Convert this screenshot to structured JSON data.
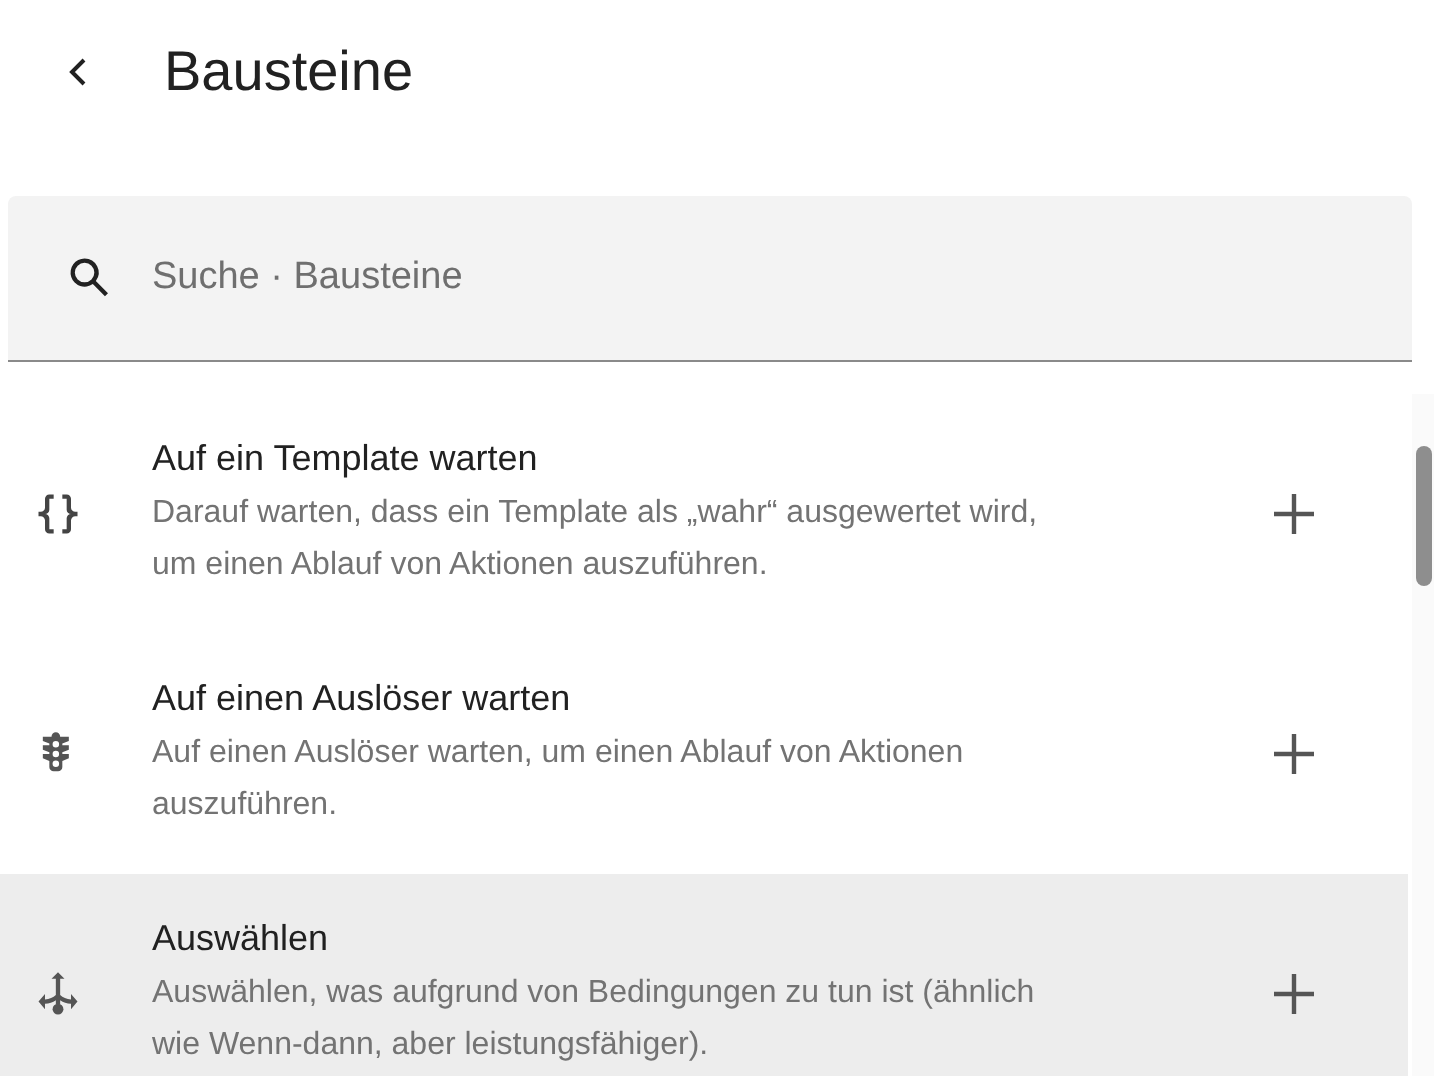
{
  "header": {
    "title": "Bausteine"
  },
  "search": {
    "placeholder": "Suche · Bausteine"
  },
  "items": [
    {
      "kind": "template",
      "title": "Auf ein Template warten",
      "description": "Darauf warten, dass ein Template als „wahr“ ausgewertet wird, um einen Ablauf von Aktionen auszuführen.",
      "selected": false
    },
    {
      "kind": "trigger",
      "title": "Auf einen Auslöser warten",
      "description": "Auf einen Auslöser warten, um einen Ablauf von Aktionen auszuführen.",
      "selected": false
    },
    {
      "kind": "choose",
      "title": "Auswählen",
      "description": "Auswählen, was aufgrund von Bedingungen zu tun ist (ähnlich wie Wenn-dann, aber leistungsfähiger).",
      "selected": true
    }
  ]
}
